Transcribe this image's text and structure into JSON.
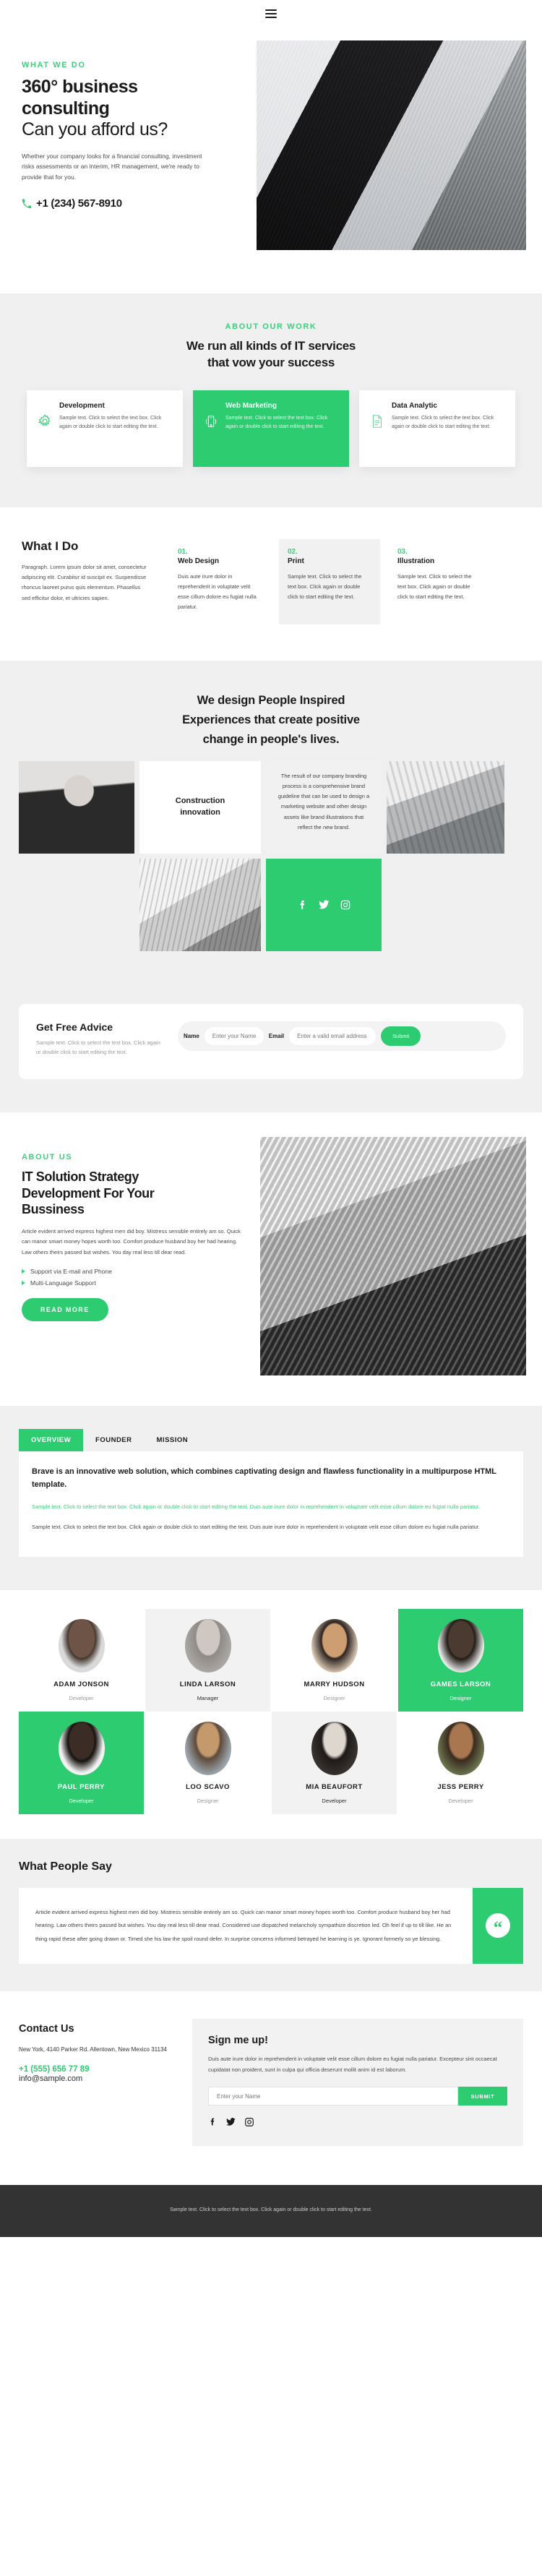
{
  "header": {
    "menu_icon": "hamburger-menu-icon"
  },
  "hero": {
    "eyebrow": "WHAT WE DO",
    "title_bold_line1": "360° business",
    "title_bold_line2": "consulting",
    "title_light": "Can you afford us?",
    "lead": "Whether your company looks for a financial consulting, investment risks assessments or an interim, HR management, we're ready to provide that for you.",
    "phone": "+1 (234) 567-8910",
    "phone_icon": "phone-icon",
    "image_alt": "modern-building-photo"
  },
  "services": {
    "eyebrow": "ABOUT OUR WORK",
    "title_line1": "We run all kinds of IT services",
    "title_line2": "that vow your success",
    "cards": [
      {
        "icon": "gear-icon",
        "title": "Development",
        "text": "Sample text. Click to select the text box. Click again or double click to start editing the text."
      },
      {
        "icon": "mobile-signal-icon",
        "title": "Web Marketing",
        "text": "Sample text. Click to select the text box. Click again or double click to start editing the text."
      },
      {
        "icon": "document-icon",
        "title": "Data Analytic",
        "text": "Sample text. Click to select the text box. Click again or double click to start editing the text."
      }
    ]
  },
  "whatido": {
    "title": "What I Do",
    "intro": "Paragraph. Lorem ipsum dolor sit amet, consectetur adipiscing elit. Curabitur id suscipit ex. Suspendisse rhoncus laoreet purus quis elementum. Phasellus sed efficitur dolor, et ultricies sapien.",
    "steps": [
      {
        "num": "01.",
        "title": "Web Design",
        "text": "Duis aute irure dolor in reprehenderit in voluptate velit esse cillum dolore eu fugiat nulla pariatur."
      },
      {
        "num": "02.",
        "title": "Print",
        "text": "Sample text. Click to select the text box. Click again or double click to start editing the text."
      },
      {
        "num": "03.",
        "title": "Illustration",
        "text": "Sample text. Click to select the text box. Click again or double click to start editing the text."
      }
    ]
  },
  "design": {
    "title_line1": "We design People Inspired",
    "title_line2": "Experiences that create positive",
    "title_line3": "change in people's lives.",
    "card_title_line1": "Construction",
    "card_title_line2": "innovation",
    "card_text": "The result of our company branding process is a comprehensive brand guideline that can be used to design a marketing website and other design assets like brand illustrations that reflect the new brand.",
    "socials": [
      "facebook-icon",
      "twitter-icon",
      "instagram-icon"
    ]
  },
  "advice": {
    "title": "Get Free Advice",
    "text": "Sample text. Click to select the text box. Click again or double click to start editing the text.",
    "name_label": "Name",
    "name_placeholder": "Enter your Name",
    "email_label": "Email",
    "email_placeholder": "Enter a valid email address",
    "submit_label": "Submit"
  },
  "about": {
    "eyebrow": "ABOUT US",
    "title_line1": "IT Solution Strategy",
    "title_line2": "Development For Your",
    "title_line3": "Bussiness",
    "body": "Article evident arrived express highest men did boy. Mistress sensible entirely am so. Quick can manor smart money hopes worth too. Comfort produce husband boy her had hearing. Law others theirs passed but wishes. You day real less till dear read.",
    "bullets": [
      "Support via E-mail and Phone",
      "Multi-Language Support"
    ],
    "button_label": "READ MORE"
  },
  "tabs": {
    "items": [
      {
        "label": "OVERVIEW",
        "active": true
      },
      {
        "label": "FOUNDER",
        "active": false
      },
      {
        "label": "MISSION",
        "active": false
      }
    ],
    "panel_heading": "Brave is an innovative web solution, which combines captivating design and flawless functionality in a multipurpose HTML template.",
    "panel_green": "Sample text. Click to select the text box. Click again or double click to start editing the text. Duis aute irure dolor in reprehenderit in voluptate velit esse cillum dolore eu fugiat nulla pariatur.",
    "panel_gray": "Sample text. Click to select the text box. Click again or double click to start editing the text. Duis aute irure dolor in reprehenderit in voluptate velit esse cillum dolore eu fugiat nulla pariatur."
  },
  "team": {
    "row1": [
      {
        "name": "ADAM JONSON",
        "role": "Developer",
        "style": "plain",
        "avatar": "a1"
      },
      {
        "name": "LINDA LARSON",
        "role": "Manager",
        "style": "gray",
        "avatar": "a2"
      },
      {
        "name": "MARRY HUDSON",
        "role": "Designer",
        "style": "plain",
        "avatar": "a3"
      },
      {
        "name": "GAMES LARSON",
        "role": "Designer",
        "style": "green",
        "avatar": "a4"
      }
    ],
    "row2": [
      {
        "name": "PAUL PERRY",
        "role": "Developer",
        "style": "green",
        "avatar": "a5"
      },
      {
        "name": "LOO SCAVO",
        "role": "Designer",
        "style": "plain",
        "avatar": "a6"
      },
      {
        "name": "MIA BEAUFORT",
        "role": "Developer",
        "style": "gray",
        "avatar": "a7"
      },
      {
        "name": "JESS PERRY",
        "role": "Developer",
        "style": "plain",
        "avatar": "a8"
      }
    ]
  },
  "testimonial": {
    "title": "What People Say",
    "quote": "Article evident arrived express highest men did boy. Mistress sensible entirely am so. Quick can manor smart money hopes worth too. Comfort produce husband boy her had hearing. Law others theirs passed but wishes. You day real less till dear read. Considered use dispatched melancholy sympathize discretion led. Oh feel if up to till like. He an thing rapid these after going drawn or. Timed she his law the spoil round defer. In surprise concerns informed betrayed he learning is ye. Ignorant formerly so ye blessing.",
    "quote_icon": "quote-mark-icon"
  },
  "contact": {
    "title": "Contact Us",
    "address": "New York, 4140 Parker Rd. Allentown, New Mexico 31134",
    "phone": "+1 (555) 656 77 89",
    "email": "info@sample.com"
  },
  "signup": {
    "title": "Sign me up!",
    "text": "Duis aute irure dolor in reprehenderit in voluptate velit esse cillum dolore eu fugiat nulla pariatur. Excepteur sint occaecat cupidatat non proident, sunt in culpa qui officia deserunt mollit anim id est laborum.",
    "name_placeholder": "Enter your Name",
    "submit_label": "SUBMIT",
    "socials": [
      "facebook-icon",
      "twitter-icon",
      "instagram-icon"
    ]
  },
  "footer": {
    "text": "Sample text. Click to select the text box. Click again or double click to start editing the text."
  },
  "colors": {
    "accent": "#2ecc71",
    "accent_light": "#3ecf7e",
    "gray_bg": "#f0f0f0",
    "footer_bg": "#333333"
  }
}
